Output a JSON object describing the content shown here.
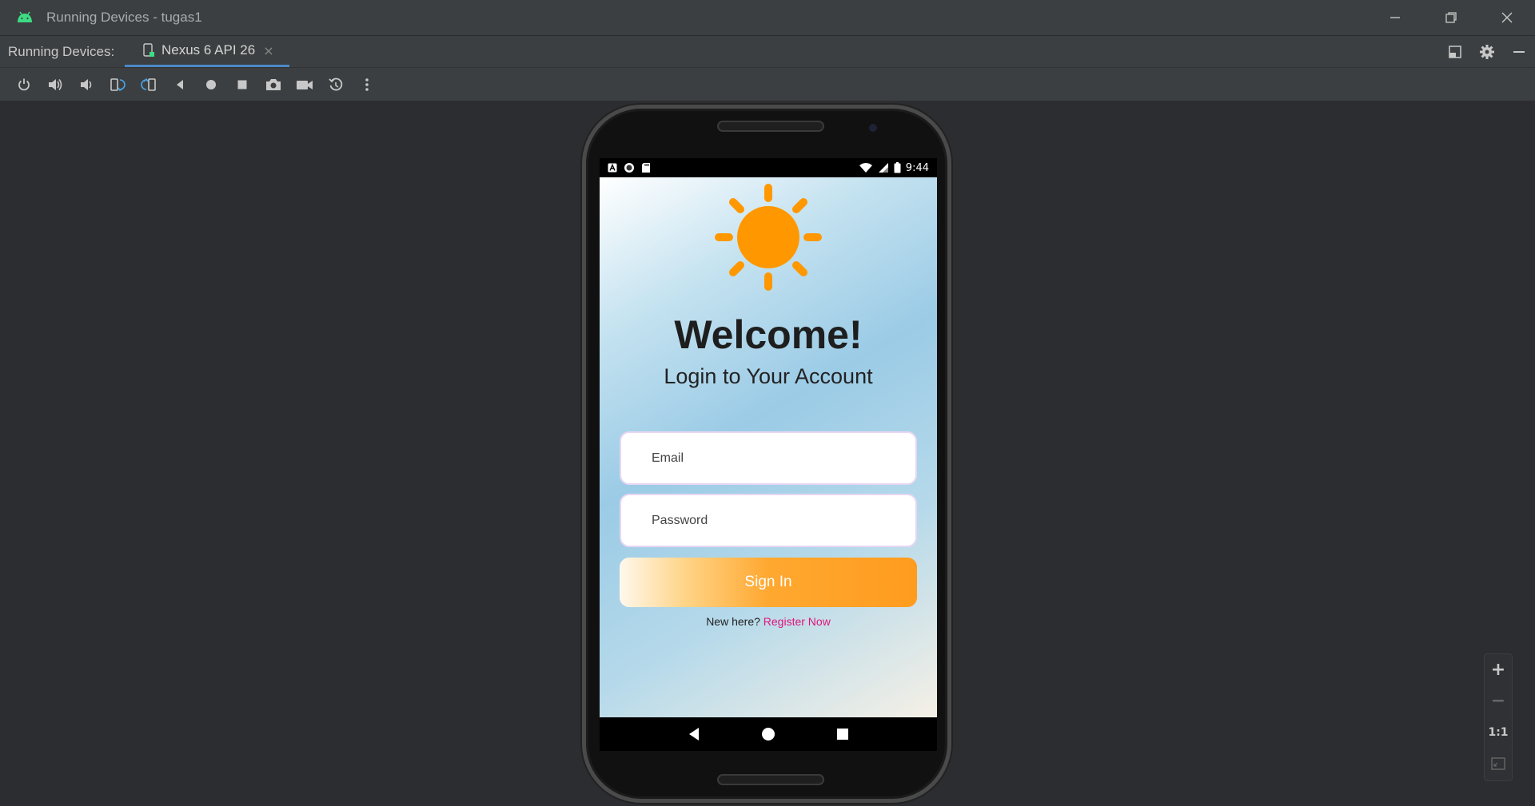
{
  "window": {
    "title": "Running Devices - tugas1",
    "minimize_icon": "minimize-icon",
    "restore_icon": "restore-icon",
    "close_icon": "close-icon"
  },
  "tabbar": {
    "label": "Running Devices:",
    "tab_label": "Nexus 6 API 26",
    "tab_close": "×"
  },
  "toolbar": {
    "icons": [
      "power-icon",
      "volume-up-icon",
      "volume-down-icon",
      "rotate-left-icon",
      "rotate-right-icon",
      "back-icon",
      "home-icon",
      "overview-icon",
      "screenshot-icon",
      "screen-record-icon",
      "reset-icon",
      "more-icon"
    ]
  },
  "phone": {
    "status_time": "9:44",
    "welcome": "Welcome!",
    "subtitle": "Login to Your Account",
    "email_placeholder": "Email",
    "password_placeholder": "Password",
    "signin_label": "Sign In",
    "register_prefix": "New here?",
    "register_link": "Register Now"
  },
  "zoom": {
    "zoom_in": "+",
    "zoom_out": "−",
    "actual_size": "1:1"
  },
  "colors": {
    "accent": "#4a88c7",
    "sun": "#ff9800",
    "link": "#e0147c",
    "signin": "#ffa830"
  }
}
